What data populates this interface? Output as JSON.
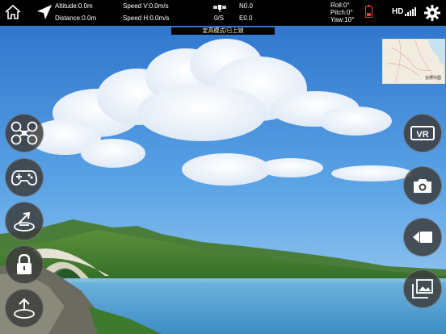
{
  "telemetry": {
    "altitude": "Altitude:0.0m",
    "distance": "Distance:0.0m",
    "speed_v": "Speed V:0.0m/s",
    "speed_h": "Speed H:0.0m/s",
    "gps_count": "0/S",
    "north": "N0.0",
    "east": "E0.0",
    "roll": "Roll:0°",
    "pitch": "Pitch:0°",
    "yaw": "Yaw:10°",
    "hd_label": "HD"
  },
  "status_banner": "定高模式/已上锁",
  "minimap": {
    "label": "瓦楞中图"
  },
  "colors": {
    "topbar": "#000000",
    "battery": "#e53935",
    "button_bg": "#3c3c3c"
  },
  "left_buttons": [
    "drone-icon",
    "gamepad-icon",
    "takeoff-land-icon",
    "lock-icon",
    "home-return-icon"
  ],
  "right_buttons": [
    "vr-icon",
    "camera-icon",
    "video-icon",
    "gallery-icon"
  ]
}
